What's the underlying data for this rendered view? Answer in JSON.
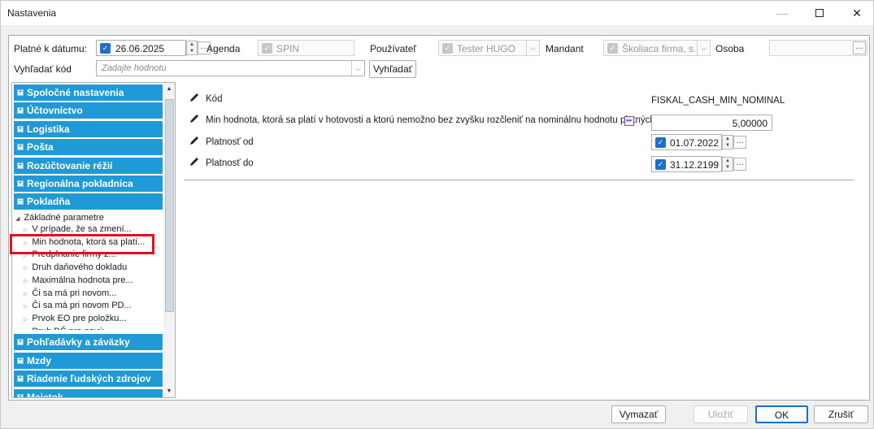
{
  "window": {
    "title": "Nastavenia"
  },
  "filters": {
    "date_label": "Platné k dátumu:",
    "date_value": "26.06.2025",
    "agenda_label": "Agenda",
    "agenda_value": "SPIN",
    "user_label": "Používateľ",
    "user_value": "Tester HUGO",
    "mandant_label": "Mandant",
    "mandant_value": "Školiaca firma, s.r.o",
    "person_label": "Osoba",
    "person_value": "",
    "search_label": "Vyhľadať kód",
    "search_placeholder": "Zadajte hodnotu",
    "search_button": "Vyhľadať"
  },
  "sidebar": {
    "sections_top": [
      "Spoločné nastavenia",
      "Účtovníctvo",
      "Logistika",
      "Pošta",
      "Rozúčtovanie réžií",
      "Regionálna pokladnica",
      "Pokladňa"
    ],
    "tree": {
      "root": "Základné parametre",
      "items": [
        "V prípade, že sa zmení...",
        "Min hodnota, ktorá sa platí...",
        "Predplnanie firmy z...",
        "Druh daňového dokladu",
        "Maximálna hodnota pre...",
        "Či sa má pri novom...",
        "Či sa má pri novom PD...",
        "Prvok EO pre položku...",
        "Druh DŠ pre nový..."
      ]
    },
    "sections_bottom": [
      "Pohľadávky a záväzky",
      "Mzdy",
      "Riadenie ľudských zdrojov",
      "Majetok"
    ]
  },
  "detail": {
    "code_label": "Kód",
    "code_value": "FISKAL_CASH_MIN_NOMINAL",
    "min_label": "Min hodnota, ktorá sa platí v hotovosti a ktorú nemožno bez zvyšku rozčleniť na nominálnu hodnotu platných m",
    "min_value": "5,00000",
    "valid_from_label": "Platnosť od",
    "valid_from_value": "01.07.2022",
    "valid_to_label": "Platnosť do",
    "valid_to_value": "31.12.2199"
  },
  "footer": {
    "clear": "Vymazať",
    "save": "Uložiť",
    "ok": "OK",
    "cancel": "Zrušiť"
  },
  "colors": {
    "section_bg": "#1f9ad6",
    "checkbox": "#1e6fc8",
    "highlight": "#e3101c"
  }
}
